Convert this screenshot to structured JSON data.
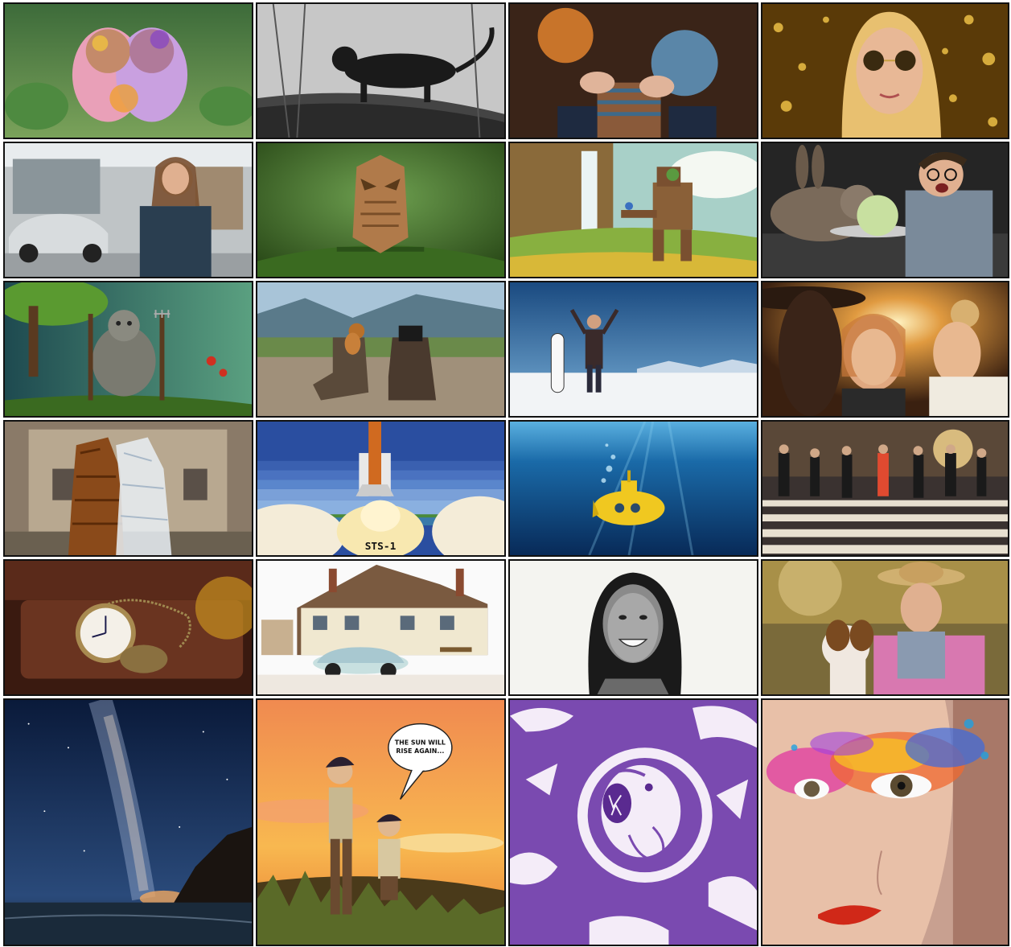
{
  "gallery": {
    "tiles": [
      {
        "id": "holi-friends"
      },
      {
        "id": "black-panther-sketch"
      },
      {
        "id": "knitting-hands"
      },
      {
        "id": "woman-sunglasses-gold"
      },
      {
        "id": "mechanic-woman-garage"
      },
      {
        "id": "origami-owl"
      },
      {
        "id": "robot-waterfall"
      },
      {
        "id": "rabbit-cabbage-man"
      },
      {
        "id": "stone-golem-garden"
      },
      {
        "id": "squirrel-boots"
      },
      {
        "id": "snowboarder-mountain"
      },
      {
        "id": "friends-sunset"
      },
      {
        "id": "wood-crystal-figures"
      },
      {
        "id": "space-shuttle-pixel"
      },
      {
        "id": "yellow-submarine"
      },
      {
        "id": "street-crosswalk"
      },
      {
        "id": "pocket-watch"
      },
      {
        "id": "pub-car-watercolor"
      },
      {
        "id": "smiling-woman-sketch"
      },
      {
        "id": "woman-dog-hat"
      },
      {
        "id": "milky-way-coast"
      },
      {
        "id": "anime-sunset-boys"
      },
      {
        "id": "lion-purple-pattern"
      },
      {
        "id": "colorful-eye-makeup"
      }
    ],
    "texts": {
      "shuttle_label": "STS-1",
      "bubble_line1": "THE SUN WILL",
      "bubble_line2": "RISE AGAIN..."
    },
    "colors": {
      "border": "#111111",
      "background": "#ffffff"
    }
  }
}
